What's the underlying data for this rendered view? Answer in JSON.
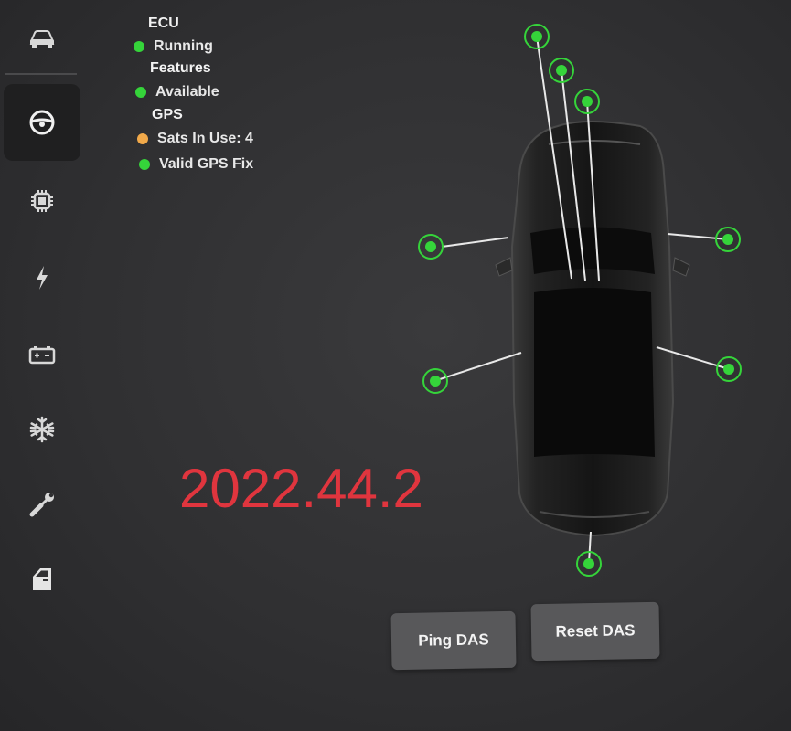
{
  "status": {
    "ecu": {
      "heading": "ECU",
      "state": "Running",
      "color": "#35d43a"
    },
    "features": {
      "heading": "Features",
      "state": "Available",
      "color": "#35d43a"
    },
    "gps": {
      "heading": "GPS",
      "sats": {
        "text": "Sats In Use: 4",
        "color": "#f1a94a"
      },
      "fix": {
        "text": "Valid GPS Fix",
        "color": "#35d43a"
      }
    }
  },
  "version": {
    "text": "2022.44.2",
    "color": "#e0353e"
  },
  "camera_indicator_color": "#35d43a",
  "buttons": {
    "ping": "Ping DAS",
    "reset": "Reset DAS"
  },
  "sidebar": {
    "icons": [
      "car-icon",
      "steering-wheel-icon",
      "chip-icon",
      "lightning-icon",
      "battery-icon",
      "snowflake-icon",
      "wrench-icon",
      "door-icon"
    ],
    "active": "steering-wheel-icon"
  }
}
